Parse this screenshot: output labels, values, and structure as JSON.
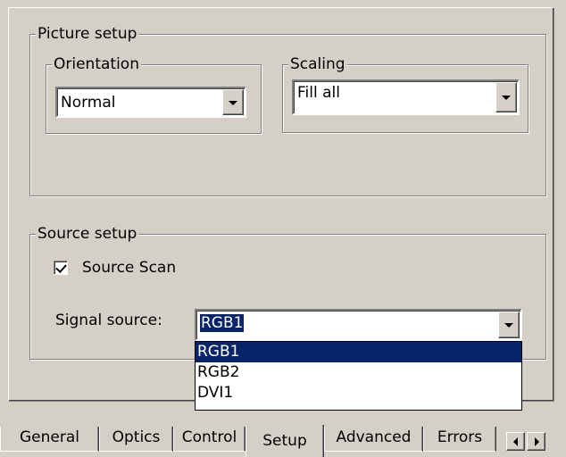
{
  "picture_setup": {
    "label": "Picture setup",
    "orientation": {
      "label": "Orientation",
      "value": "Normal"
    },
    "scaling": {
      "label": "Scaling",
      "value": "Fill all"
    }
  },
  "source_setup": {
    "label": "Source setup",
    "source_scan": {
      "label": "Source Scan",
      "checked": true
    },
    "signal_source": {
      "label": "Signal source:",
      "value": "RGB1",
      "options": [
        "RGB1",
        "RGB2",
        "DVI1"
      ]
    }
  },
  "tabs": [
    "General",
    "Optics",
    "Control",
    "Setup",
    "Advanced",
    "Errors"
  ],
  "active_tab": "Setup",
  "colors": {
    "face": "#d4d0c8",
    "highlight": "#0a246a"
  },
  "icons": {
    "dropdown": "chevron-down-icon",
    "scroll_left": "arrow-left-icon",
    "scroll_right": "arrow-right-icon",
    "check": "checkmark-icon"
  }
}
